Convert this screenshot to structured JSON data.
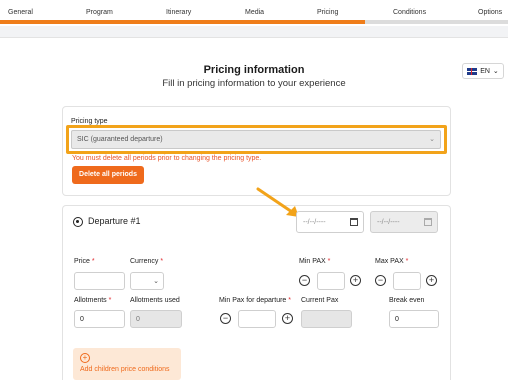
{
  "steps": [
    "General",
    "Program",
    "Itinerary",
    "Media",
    "Pricing",
    "Conditions",
    "Options"
  ],
  "active_step": "Pricing",
  "accent_color": "#ef7d1a",
  "highlight_color": "#f2a31a",
  "language": {
    "code": "EN",
    "flag": "uk-flag-icon"
  },
  "header": {
    "title": "Pricing information",
    "subtitle": "Fill in pricing information to your experience"
  },
  "pricing_type": {
    "label": "Pricing type",
    "selected": "SIC (guaranteed departure)",
    "error": "You must delete all periods prior to changing the pricing type.",
    "delete_button": "Delete all periods"
  },
  "departure": {
    "title": "Departure #1",
    "date_from_placeholder": "--/--/----",
    "date_to_placeholder": "--/--/----",
    "fields": {
      "price": "Price",
      "currency": "Currency",
      "min_pax": "Min PAX",
      "max_pax": "Max PAX",
      "allotments": "Allotments",
      "allotments_used": "Allotments used",
      "min_pax_departure": "Min Pax for departure",
      "current_pax": "Current Pax",
      "break_even": "Break even"
    },
    "values": {
      "allotments": "0",
      "allotments_used": "0",
      "break_even": "0"
    },
    "add_children": "Add children price conditions"
  }
}
